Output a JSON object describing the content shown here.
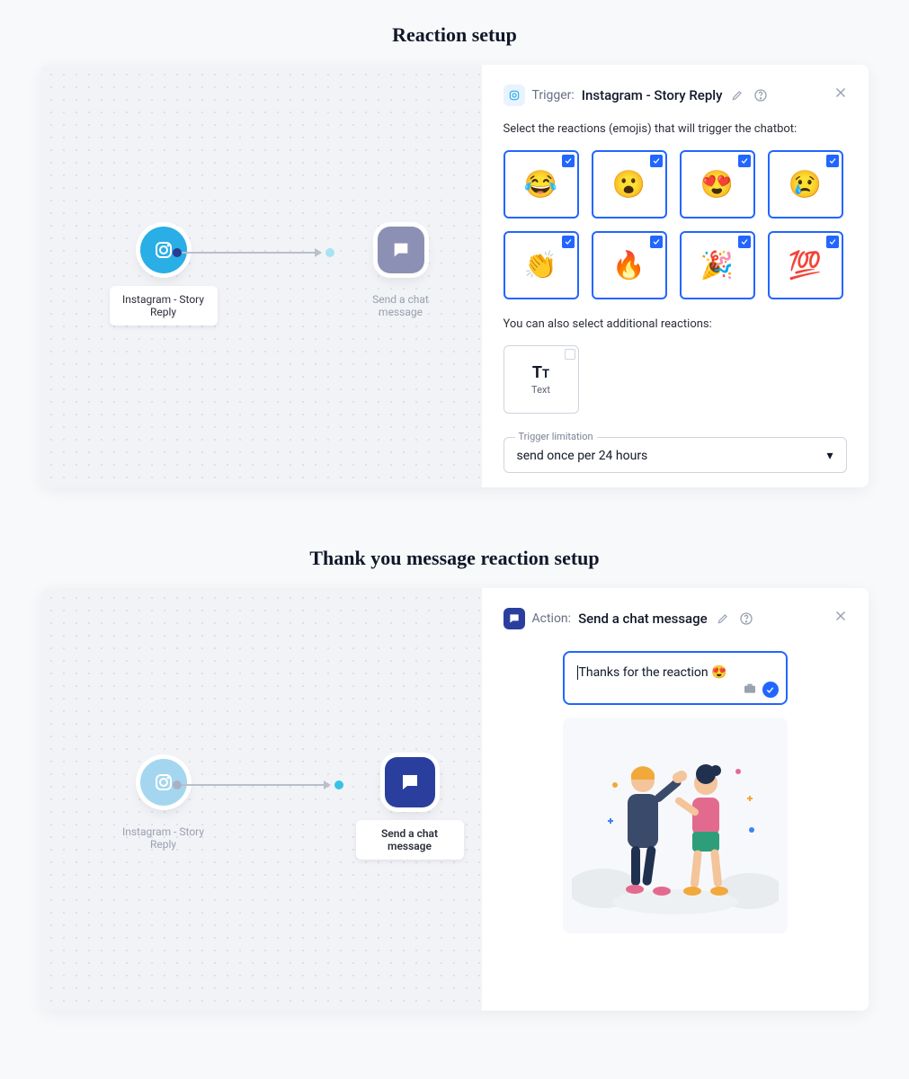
{
  "sections": {
    "reaction": {
      "title": "Reaction setup",
      "flow": {
        "trigger_node": "Instagram - Story Reply",
        "action_node": "Send a chat message"
      },
      "panel": {
        "label": "Trigger:",
        "name": "Instagram - Story Reply",
        "desc": "Select the reactions (emojis) that will trigger the chatbot:",
        "emojis": [
          "😂",
          "😮",
          "😍",
          "😢",
          "👏",
          "🔥",
          "🎉",
          "💯"
        ],
        "additional_desc": "You can also select additional reactions:",
        "additional_card": {
          "glyph_big": "T",
          "glyph_small": "T",
          "label": "Text"
        },
        "limitation_label": "Trigger limitation",
        "limitation_value": "send once per 24 hours"
      }
    },
    "thankyou": {
      "title": "Thank you message reaction setup",
      "flow": {
        "trigger_node": "Instagram - Story Reply",
        "action_node": "Send a chat message"
      },
      "panel": {
        "label": "Action:",
        "name": "Send a chat message",
        "message_text": "Thanks for the reaction 😍"
      }
    }
  }
}
